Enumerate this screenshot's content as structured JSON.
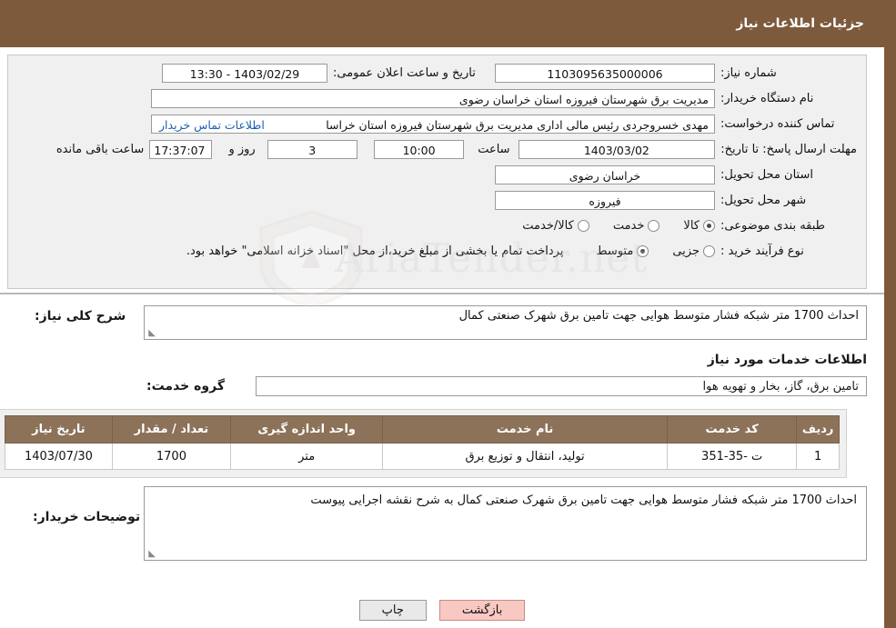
{
  "header": {
    "title": "جزئیات اطلاعات نیاز"
  },
  "watermark": {
    "text": "AriaTender.net"
  },
  "top_panel": {
    "niaz_number_label": "شماره نیاز:",
    "niaz_number_value": "1103095635000006",
    "announce_date_label": "تاریخ و ساعت اعلان عمومی:",
    "announce_date_value": "1403/02/29 - 13:30",
    "buyer_org_label": "نام دستگاه خریدار:",
    "buyer_org_value": "مدیریت برق شهرستان فیروزه استان خراسان رضوی",
    "requester_label": "تماس کننده درخواست:",
    "requester_value": "مهدی خسروجردی رئیس مالی اداری مدیریت برق شهرستان فیروزه استان خراسا",
    "requester_link": "اطلاعات تماس خریدار",
    "deadline_label": "مهلت ارسال پاسخ: تا تاریخ:",
    "deadline_value": "1403/03/02",
    "hour_label": "ساعت",
    "hour_value": "10:00",
    "days_label": "روز و",
    "days_value": "3",
    "timer_value": "17:37:07",
    "remaining_label": "ساعت باقی مانده",
    "province_label": "استان محل تحویل:",
    "province_value": "خراسان رضوی",
    "city_label": "شهر محل تحویل:",
    "city_value": "فیروزه",
    "category_label": "طبقه بندی موضوعی:",
    "category_options": [
      {
        "label": "کالا",
        "checked": true
      },
      {
        "label": "خدمت",
        "checked": false
      },
      {
        "label": "کالا/خدمت",
        "checked": false
      }
    ],
    "process_label": "نوع فرآیند خرید :",
    "process_options": [
      {
        "label": "جزیی",
        "checked": false
      },
      {
        "label": "متوسط",
        "checked": true
      }
    ],
    "process_note": "پرداخت تمام یا بخشی از مبلغ خرید،از محل \"اسناد خزانه اسلامی\" خواهد بود."
  },
  "middle": {
    "summary_label": "شرح کلی نیاز:",
    "summary_value": "احداث 1700 متر شبکه فشار متوسط هوایی جهت تامین برق شهرک صنعتی کمال",
    "services_section_title": "اطلاعات خدمات مورد نیاز",
    "service_group_label": "گروه خدمت:",
    "service_group_value": "تامین برق، گاز، بخار و تهویه هوا"
  },
  "table": {
    "headers": [
      "ردیف",
      "کد خدمت",
      "نام خدمت",
      "واحد اندازه گیری",
      "تعداد / مقدار",
      "تاریخ نیاز"
    ],
    "rows": [
      {
        "row": "1",
        "code": "ت -35-351",
        "name": "تولید، انتقال و توزیع برق",
        "unit": "متر",
        "quantity": "1700",
        "date": "1403/07/30"
      }
    ]
  },
  "buyer_desc": {
    "label": "توضیحات خریدار:",
    "value": "احداث 1700 متر شبکه فشار متوسط هوایی جهت تامین برق شهرک صنعتی کمال به شرح نقشه اجرایی پیوست"
  },
  "buttons": {
    "print": "چاپ",
    "back": "بازگشت"
  }
}
